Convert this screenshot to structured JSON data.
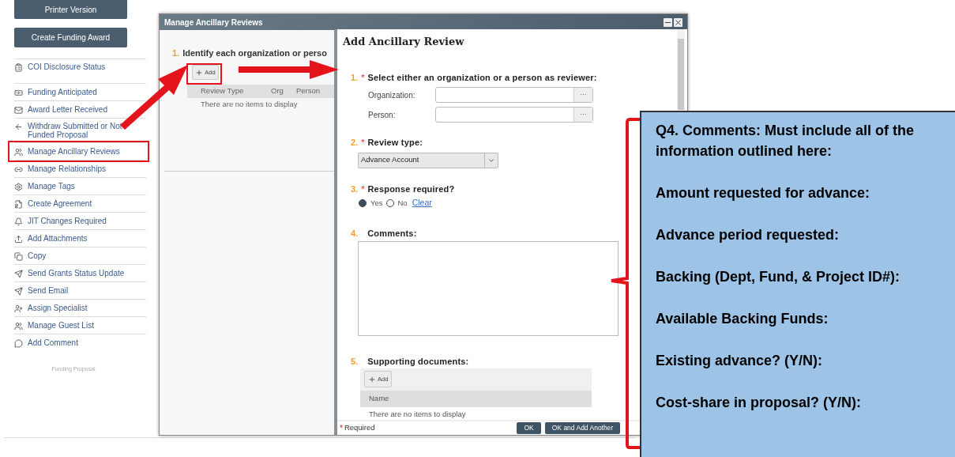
{
  "sidebar": {
    "buttons": [
      "Printer Version",
      "Create Funding Award"
    ],
    "items": [
      {
        "label": "COI Disclosure Status",
        "highlighted": false
      },
      {
        "label": "Funding Anticipated",
        "highlighted": false
      },
      {
        "label": "Award Letter Received",
        "highlighted": false
      },
      {
        "label": "Withdraw Submitted or Not Funded Proposal",
        "highlighted": false
      },
      {
        "label": "Manage Ancillary Reviews",
        "highlighted": true
      },
      {
        "label": "Manage Relationships",
        "highlighted": false
      },
      {
        "label": "Manage Tags",
        "highlighted": false
      },
      {
        "label": "Create Agreement",
        "highlighted": false
      },
      {
        "label": "JIT Changes Required",
        "highlighted": false
      },
      {
        "label": "Add Attachments",
        "highlighted": false
      },
      {
        "label": "Copy",
        "highlighted": false
      },
      {
        "label": "Send Grants Status Update",
        "highlighted": false
      },
      {
        "label": "Send Email",
        "highlighted": false
      },
      {
        "label": "Assign Specialist",
        "highlighted": false
      },
      {
        "label": "Manage Guest List",
        "highlighted": false
      },
      {
        "label": "Add Comment",
        "highlighted": false
      }
    ],
    "footer": "Funding Proposal"
  },
  "manage_dialog": {
    "title": "Manage Ancillary Reviews",
    "step_number": "1.",
    "step_label": "Identify each organization or perso",
    "add_button": "Add",
    "columns": [
      "Review Type",
      "Org",
      "Person"
    ],
    "empty_text": "There are no items to display"
  },
  "add_dialog": {
    "title": "Add Ancillary Review",
    "questions": [
      {
        "kind": "picker",
        "number": "1.",
        "required_mark": "*",
        "label": "Select either an organization or a person as reviewer:",
        "fields": [
          {
            "label": "Organization:",
            "button": "···"
          },
          {
            "label": "Person:",
            "button": "···"
          }
        ]
      },
      {
        "kind": "select",
        "number": "2.",
        "required_mark": "*",
        "label": "Review type:",
        "value": "Advance Account"
      },
      {
        "kind": "radio",
        "number": "3.",
        "required_mark": "*",
        "label": "Response required?",
        "options": [
          {
            "label": "Yes",
            "selected": true
          },
          {
            "label": "No",
            "selected": false
          }
        ],
        "clear_link": "Clear"
      },
      {
        "kind": "textarea",
        "number": "4.",
        "label": "Comments:"
      },
      {
        "kind": "documents",
        "number": "5.",
        "label": "Supporting documents:",
        "add_button": "Add",
        "columns": [
          "Name"
        ],
        "empty_text": "There are no items to display"
      }
    ],
    "footer": {
      "mark": "*",
      "text": "Required"
    },
    "buttons": [
      "OK",
      "OK and Add Another"
    ]
  },
  "callout": {
    "heading": "Q4. Comments: Must include all of the information outlined here:",
    "lines": [
      "Amount requested for advance:",
      "Advance period requested:",
      "Backing (Dept, Fund, & Project ID#):",
      "Available Backing Funds:",
      "Existing advance? (Y/N):",
      "Cost-share in proposal? (Y/N):"
    ]
  }
}
